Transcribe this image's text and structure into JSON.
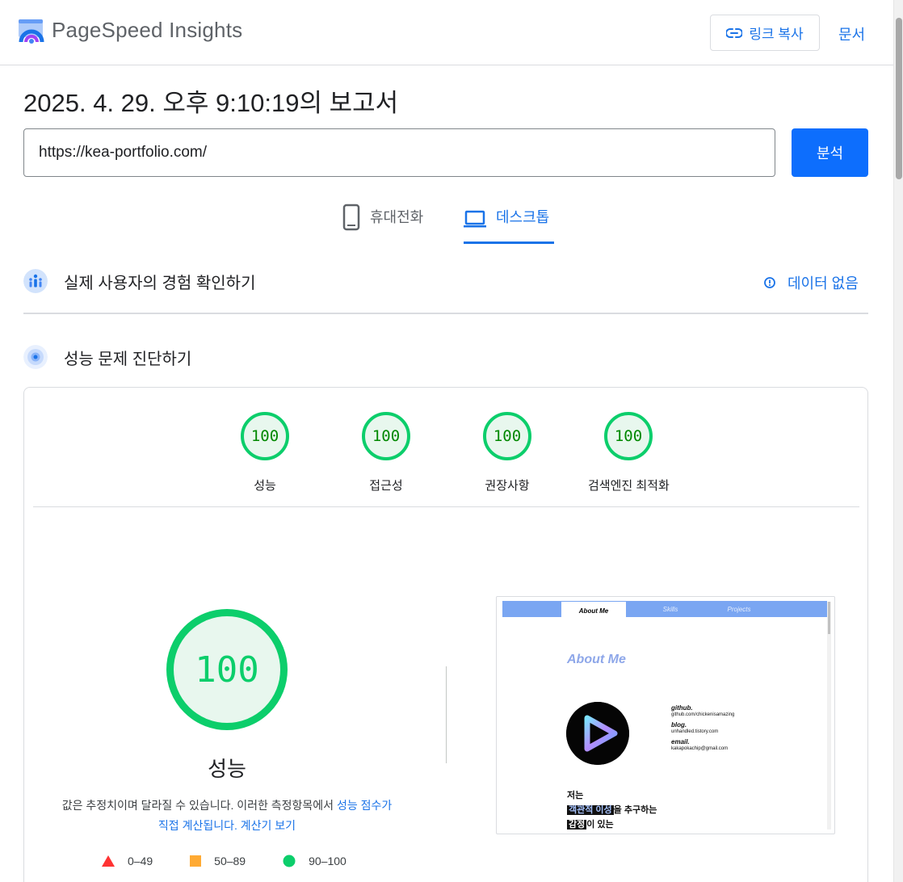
{
  "header": {
    "brand": "PageSpeed Insights",
    "copy_link_label": "링크 복사",
    "docs_label": "문서"
  },
  "report": {
    "title": "2025. 4. 29. 오후 9:10:19의 보고서",
    "url_value": "https://kea-portfolio.com/",
    "analyze_label": "분석"
  },
  "tabs": {
    "mobile": "휴대전화",
    "desktop": "데스크톱",
    "active": "desktop"
  },
  "crux": {
    "title": "실제 사용자의 경험 확인하기",
    "no_data_label": "데이터 없음"
  },
  "diagnostics": {
    "title": "성능 문제 진단하기",
    "scores": [
      {
        "label": "성능",
        "score": "100"
      },
      {
        "label": "접근성",
        "score": "100"
      },
      {
        "label": "권장사항",
        "score": "100"
      },
      {
        "label": "검색엔진 최적화",
        "score": "100"
      }
    ],
    "main_score": "100",
    "main_label": "성능",
    "desc_prefix": "값은 추정치이며 달라질 수 있습니다. 이러한 측정항목에서 ",
    "desc_link1": "성능 점수가",
    "desc_link2": "직접 계산됩니다.",
    "desc_link3": "계산기 보기",
    "legend": [
      {
        "range": "0–49",
        "color": "#ff3333",
        "shape": "triangle"
      },
      {
        "range": "50–89",
        "color": "#ffaa33",
        "shape": "square"
      },
      {
        "range": "90–100",
        "color": "#0cce6b",
        "shape": "circle"
      }
    ]
  },
  "thumbnail": {
    "tab_about": "About Me",
    "tab_skills": "Skills",
    "tab_projects": "Projects",
    "title": "About Me",
    "github_label": "github.",
    "github_value": "github.com/chickenisamazing",
    "blog_label": "blog.",
    "blog_value": "unhandled.tistory.com",
    "email_label": "email.",
    "email_value": "kakapokachip@gmail.com",
    "intro_line1": "저는",
    "intro_hl1": "객관적 이성",
    "intro_line2_rest": "을 추구하는",
    "intro_hl2": "감정",
    "intro_line3_rest": "이 있는"
  },
  "colors": {
    "accent": "#1a73e8",
    "primary_button": "#0d6efd",
    "pass_green": "#0cce6b",
    "pass_bg": "#e8f7ee"
  }
}
